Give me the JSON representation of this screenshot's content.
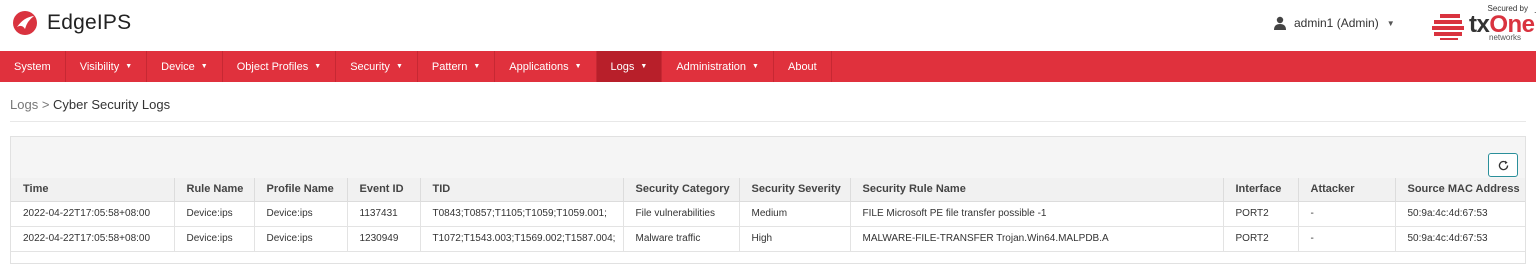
{
  "app": {
    "title": "EdgeIPS"
  },
  "user": {
    "label": "admin1 (Admin)"
  },
  "brand": {
    "secured_by": "Secured by",
    "name_prefix": "tx",
    "name_suffix": "One",
    "tm": "TM",
    "sub": "networks",
    "color": "#d9333f"
  },
  "nav": {
    "items": [
      {
        "label": "System",
        "caret": ""
      },
      {
        "label": "Visibility",
        "caret": "▼"
      },
      {
        "label": "Device",
        "caret": "▼"
      },
      {
        "label": "Object Profiles",
        "caret": "▼"
      },
      {
        "label": "Security",
        "caret": "▼"
      },
      {
        "label": "Pattern",
        "caret": "▼"
      },
      {
        "label": "Applications",
        "caret": "▼"
      },
      {
        "label": "Logs",
        "caret": "▼"
      },
      {
        "label": "Administration",
        "caret": "▼"
      },
      {
        "label": "About",
        "caret": ""
      }
    ],
    "active_index": 7,
    "colors": {
      "bar": "#e0313d",
      "active": "#b81f2a"
    }
  },
  "breadcrumb": {
    "parent": "Logs",
    "separator": ">",
    "current": "Cyber Security Logs"
  },
  "toolbar": {
    "refresh_icon": "refresh-icon"
  },
  "table": {
    "columns": [
      "Time",
      "Rule Name",
      "Profile Name",
      "Event ID",
      "TID",
      "Security Category",
      "Security Severity",
      "Security Rule Name",
      "Interface",
      "Attacker",
      "Source MAC Address"
    ],
    "rows": [
      [
        "2022-04-22T17:05:58+08:00",
        "Device:ips",
        "Device:ips",
        "1137431",
        "T0843;T0857;T1105;T1059;T1059.001;",
        "File vulnerabilities",
        "Medium",
        "FILE Microsoft PE file transfer possible -1",
        "PORT2",
        "-",
        "50:9a:4c:4d:67:53"
      ],
      [
        "2022-04-22T17:05:58+08:00",
        "Device:ips",
        "Device:ips",
        "1230949",
        "T1072;T1543.003;T1569.002;T1587.004;",
        "Malware traffic",
        "High",
        "MALWARE-FILE-TRANSFER Trojan.Win64.MALPDB.A",
        "PORT2",
        "-",
        "50:9a:4c:4d:67:53"
      ]
    ]
  }
}
